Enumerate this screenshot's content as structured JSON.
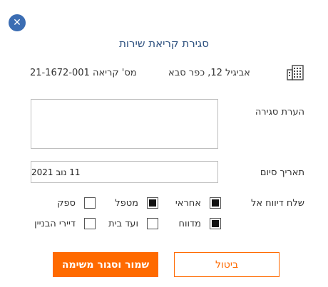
{
  "dialog": {
    "title": "סגירת קריאת שירות",
    "close_icon": "close-icon"
  },
  "info": {
    "building_icon": "building-icon",
    "address": "אביגיל 12, כפר סבא",
    "call_number": "מס' קריאה 21-1672-001"
  },
  "form": {
    "closing_note_label": "הערת סגירה",
    "closing_note_value": "",
    "end_date_label": "תאריך סיום",
    "end_date_value": "11 נוב 2021",
    "send_report_label": "שלח דיווח אל",
    "recipients": [
      {
        "label": "אחראי",
        "checked": true
      },
      {
        "label": "מטפל",
        "checked": true
      },
      {
        "label": "ספק",
        "checked": false
      },
      {
        "label": "מדווח",
        "checked": true
      },
      {
        "label": "ועד בית",
        "checked": false
      },
      {
        "label": "דיירי הבניין",
        "checked": false
      }
    ]
  },
  "actions": {
    "save_close_label": "שמור וסגור משימה",
    "cancel_label": "ביטול"
  },
  "colors": {
    "accent": "#ff6a00",
    "title": "#2b4f7e",
    "close_button": "#3b6db3"
  }
}
